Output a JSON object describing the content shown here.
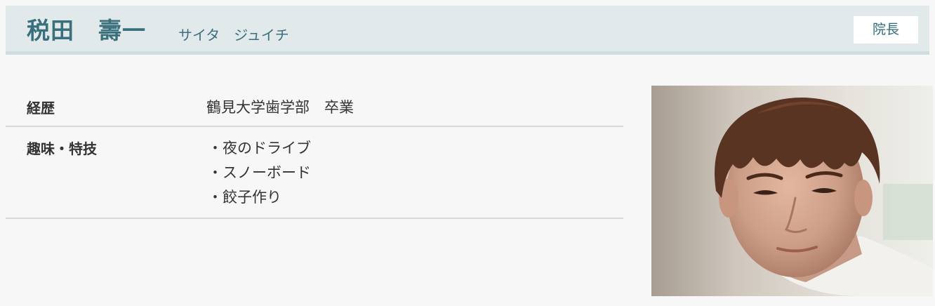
{
  "header": {
    "name_kanji": "税田　壽一",
    "name_kana": "サイタ　ジュイチ",
    "role": "院長"
  },
  "profile": {
    "career_label": "経歴",
    "career_value": "鶴見大学歯学部　卒業",
    "hobby_label": "趣味・特技",
    "hobbies": [
      "夜のドライブ",
      "スノーボード",
      "餃子作り"
    ]
  },
  "photo": {
    "icon": "portrait-photo"
  }
}
